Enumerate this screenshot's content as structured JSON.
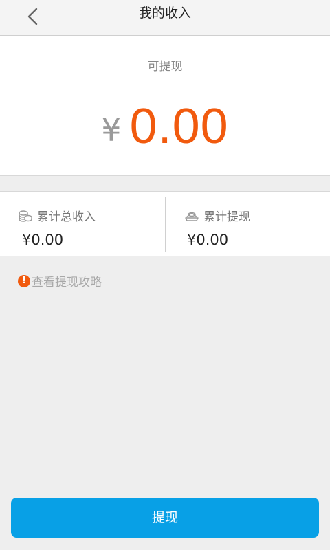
{
  "header": {
    "title": "我的收入",
    "back_icon": "chevron-left-icon"
  },
  "balance": {
    "label": "可提现",
    "currency": "¥",
    "value": "0.00",
    "accent_color": "#f15a0e"
  },
  "stats": {
    "total_income": {
      "icon": "coins-icon",
      "label": "累计总收入",
      "value": "¥0.00"
    },
    "total_withdrawn": {
      "icon": "hand-coin-icon",
      "label": "累计提现",
      "value": "¥0.00"
    }
  },
  "guide": {
    "icon": "exclamation-circle-icon",
    "text": "查看提现攻略"
  },
  "actions": {
    "withdraw_label": "提现",
    "button_color": "#08a0e6"
  }
}
